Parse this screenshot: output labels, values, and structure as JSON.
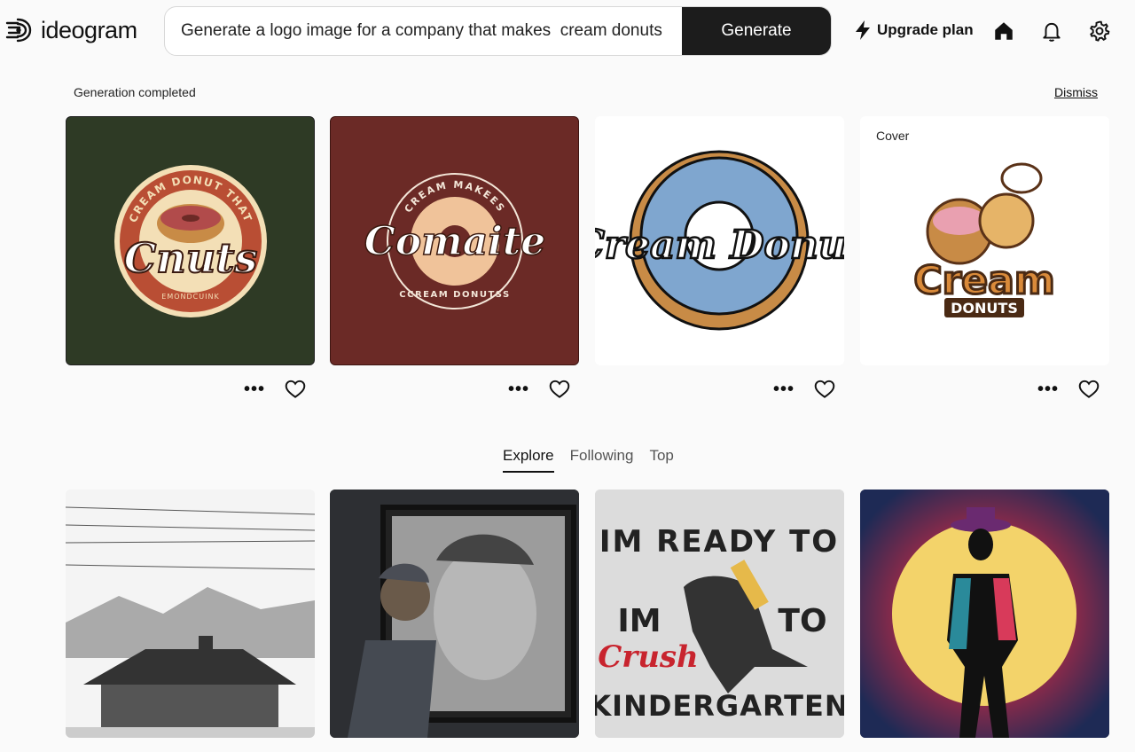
{
  "app": {
    "brand": "ideogram"
  },
  "search": {
    "value": "Generate a logo image for a company that makes  cream donuts"
  },
  "header": {
    "generate_label": "Generate",
    "upgrade_label": "Upgrade plan"
  },
  "icons": {
    "upgrade": "lightning-icon",
    "home": "home-icon",
    "notifications": "bell-icon",
    "settings": "gear-icon"
  },
  "notice": {
    "status": "Generation completed",
    "dismiss_label": "Dismiss"
  },
  "generated": [
    {
      "badge": "",
      "text_top": "CREAM DONUT THAT",
      "text_main": "Cnuts",
      "text_bottom": "EMONDCUINK",
      "bg": "#2e3a25"
    },
    {
      "badge": "",
      "text_top": "CREAM MAKEES",
      "text_main": "Comaite",
      "text_bottom": "CCREAM DONUTSS",
      "bg": "#6b2a26"
    },
    {
      "badge": "",
      "text_main": "Cream Donut",
      "bg": "#ffffff"
    },
    {
      "badge": "Cover",
      "text_main": "Cream",
      "text_bottom": "DONUTS",
      "bg": "#ffffff"
    }
  ],
  "feed_tabs": [
    {
      "label": "Explore",
      "active": true
    },
    {
      "label": "Following",
      "active": false
    },
    {
      "label": "Top",
      "active": false
    }
  ],
  "explore": [
    {
      "title": ""
    },
    {
      "title": ""
    },
    {
      "line1": "IM READY TO",
      "line2a": "IM",
      "line2b": "TO",
      "accent": "Crush",
      "line3": "KINDERGARTEN"
    },
    {
      "title": ""
    }
  ]
}
